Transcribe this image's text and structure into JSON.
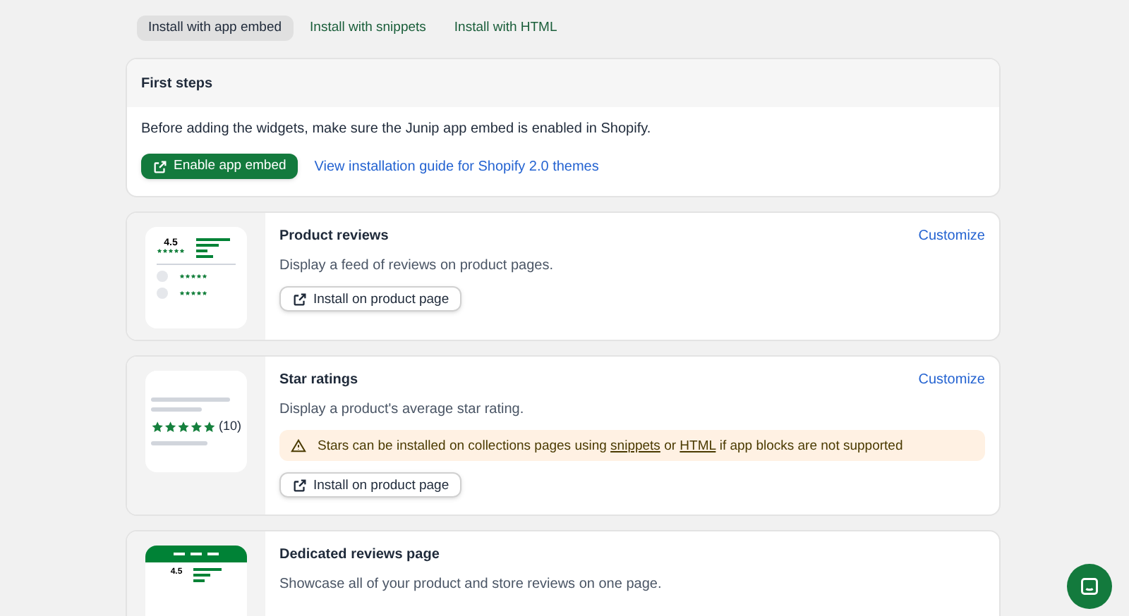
{
  "tabs": [
    {
      "label": "Install with app embed",
      "selected": true
    },
    {
      "label": "Install with snippets",
      "selected": false
    },
    {
      "label": "Install with HTML",
      "selected": false
    }
  ],
  "first_steps": {
    "title": "First steps",
    "description": "Before adding the widgets, make sure the Junip app embed is enabled in Shopify.",
    "primary_button": "Enable app embed",
    "guide_link": "View installation guide for Shopify 2.0 themes"
  },
  "widgets": [
    {
      "kind": "reviews",
      "title": "Product reviews",
      "customize": "Customize",
      "description": "Display a feed of reviews on product pages.",
      "thumbnail_rating": "4.5",
      "button": "Install on product page"
    },
    {
      "kind": "stars",
      "title": "Star ratings",
      "customize": "Customize",
      "description": "Display a product's average star rating.",
      "thumbnail_count": "(10)",
      "warning": {
        "before": "Stars can be installed on collections pages using",
        "link_1": "snippets",
        "middle": "or",
        "link_2": "HTML",
        "after": "if app blocks are not supported"
      },
      "button": "Install on product page"
    },
    {
      "kind": "page",
      "title": "Dedicated reviews page",
      "description": "Showcase all of your product and store reviews on one page.",
      "thumbnail_rating": "4.5"
    }
  ]
}
